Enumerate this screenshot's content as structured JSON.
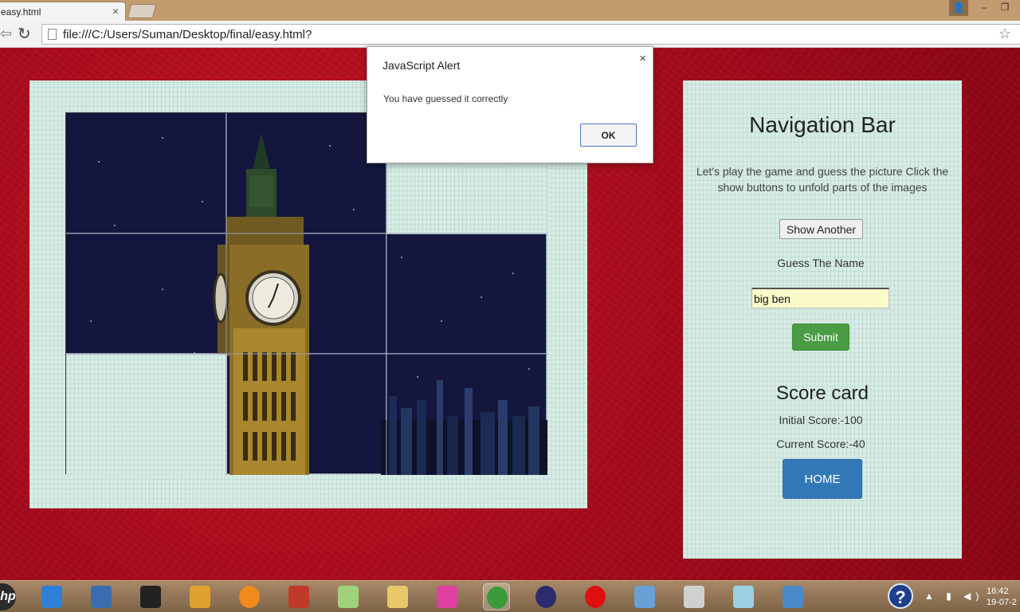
{
  "browser": {
    "tab_title": "easy.html",
    "tab_close": "×",
    "url": "file:///C:/Users/Suman/Desktop/final/easy.html?",
    "back_glyph": "⇦",
    "reload_glyph": "↻",
    "star_glyph": "☆",
    "window_controls": {
      "profile": "👤",
      "minimize": "–",
      "restore": "❐"
    }
  },
  "alert": {
    "title": "JavaScript Alert",
    "close": "×",
    "message": "You have guessed it correctly",
    "ok_label": "OK"
  },
  "puzzle": {
    "rows": 3,
    "cols": 3,
    "revealed": [
      [
        true,
        true,
        false
      ],
      [
        true,
        true,
        true
      ],
      [
        false,
        true,
        true
      ]
    ],
    "picture": "big ben clock tower at night"
  },
  "navigation": {
    "title": "Navigation Bar",
    "description": "Let's play the game and guess the picture Click the show buttons to unfold parts of the images",
    "show_button": "Show Another",
    "guess_label": "Guess The Name",
    "guess_value": "big ben",
    "submit_button": "Submit",
    "score_title": "Score card",
    "initial_score": "Initial Score:-100",
    "current_score": "Current Score:-40",
    "home_button": "HOME"
  },
  "taskbar": {
    "start_glyph": "hp",
    "help_glyph": "?",
    "tray_glyphs": "▲ ▮ ◀)",
    "time": "16:42",
    "date": "19-07-2",
    "icons": [
      {
        "name": "rocket-icon",
        "color": "#2f7fd6"
      },
      {
        "name": "kmplayer-icon",
        "color": "#3a6db0"
      },
      {
        "name": "camera-icon",
        "color": "#222222"
      },
      {
        "name": "media-player-icon",
        "color": "#e0a030"
      },
      {
        "name": "orange-app-icon",
        "color": "#f08a1a"
      },
      {
        "name": "puzzle-app-icon",
        "color": "#c03a2a"
      },
      {
        "name": "notes-icon",
        "color": "#9fd27a"
      },
      {
        "name": "folder-icon",
        "color": "#e8c86a"
      },
      {
        "name": "music-app-icon",
        "color": "#e040a0"
      },
      {
        "name": "chrome-icon",
        "color": "#3a9a3a"
      },
      {
        "name": "eclipse-icon",
        "color": "#2c2c6c"
      },
      {
        "name": "vodafone-icon",
        "color": "#e01010"
      },
      {
        "name": "virtualbox-icon",
        "color": "#6aa0d8"
      },
      {
        "name": "browser-app-icon",
        "color": "#d0d0d0"
      },
      {
        "name": "notepad-icon",
        "color": "#9ad0e0"
      },
      {
        "name": "screen-app-icon",
        "color": "#4a8ac8"
      }
    ]
  }
}
